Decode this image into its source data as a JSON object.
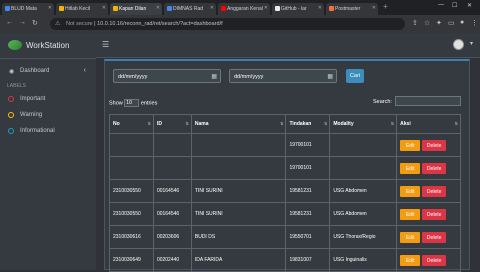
{
  "browser": {
    "tabs": [
      {
        "label": "BLUD Mata"
      },
      {
        "label": "Hitlab Kecil"
      },
      {
        "label": "Kapan Dilan"
      },
      {
        "label": "DIMNAS Rad"
      },
      {
        "label": "Anggaran Kenal"
      },
      {
        "label": "GitHub - lar"
      },
      {
        "label": "Postmaster"
      }
    ],
    "address": {
      "not_secure": "Not secure",
      "url": "10.0.10.16/reconn_rad/ret/search/?act=dashboard/f"
    }
  },
  "sidebar": {
    "brand": "WorkStation",
    "dashboard_label": "Dashboard",
    "labels_header": "LABELS",
    "labels": [
      {
        "text": "Important",
        "color": "#dc3545"
      },
      {
        "text": "Warning",
        "color": "#ffc107"
      },
      {
        "text": "Informational",
        "color": "#17a2b8"
      }
    ]
  },
  "filter": {
    "date_from_placeholder": "dd/mm/yyyy",
    "date_to_placeholder": "dd/mm/yyyy",
    "search_button": "Cari"
  },
  "table_controls": {
    "show_label": "Show",
    "show_value": "10",
    "entries_label": "entries",
    "search_label": "Search:"
  },
  "table": {
    "columns": [
      "No",
      "ID",
      "Nama",
      "Tindakan",
      "Modality",
      "Aksi"
    ],
    "rows": [
      {
        "no": "",
        "id": "",
        "nama": "",
        "tindakan": "19700101",
        "modality": ""
      },
      {
        "no": "",
        "id": "",
        "nama": "",
        "tindakan": "19700101",
        "modality": ""
      },
      {
        "no": "2310030550",
        "id": "00164546",
        "nama": "TINI SURINI",
        "tindakan": "19581231",
        "modality": "USG Abdomen"
      },
      {
        "no": "2310030550",
        "id": "00164546",
        "nama": "TINI SURINI",
        "tindakan": "19581231",
        "modality": "USG Abdomen"
      },
      {
        "no": "2310030616",
        "id": "00203606",
        "nama": "BUDI DS",
        "tindakan": "19550701",
        "modality": "USG Thorax/Regio"
      },
      {
        "no": "2310030649",
        "id": "00202440",
        "nama": "IDA FARIDA",
        "tindakan": "19831007",
        "modality": "USG Inguinalis"
      }
    ],
    "edit_label": "Edit",
    "delete_label": "Delete"
  },
  "colors": {
    "edit": "#f39c12",
    "delete": "#dc3545",
    "primary": "#3c8dbc"
  }
}
